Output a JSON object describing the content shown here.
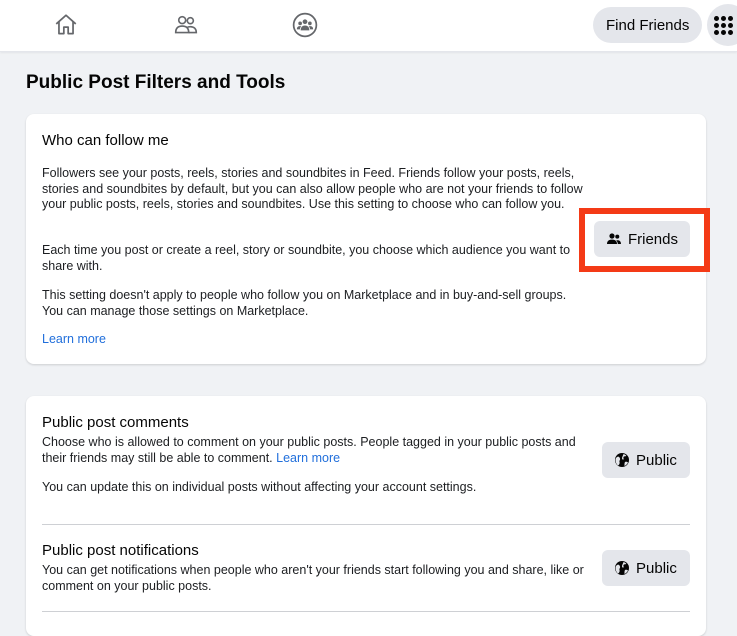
{
  "topbar": {
    "icons": [
      "home-icon",
      "friends-icon",
      "groups-icon"
    ],
    "find_friends_label": "Find Friends",
    "menu_icon": "menu-grid-icon"
  },
  "page": {
    "title": "Public Post Filters and Tools"
  },
  "who_can_follow": {
    "title": "Who can follow me",
    "paragraph1": "Followers see your posts, reels, stories and soundbites in Feed. Friends follow your posts, reels, stories and soundbites by default, but you can also allow people who are not your friends to follow your public posts, reels, stories and soundbites. Use this setting to choose who can follow you.",
    "paragraph2": "Each time you post or create a reel, story or soundbite, you choose which audience you want to share with.",
    "paragraph3": "This setting doesn't apply to people who follow you on Marketplace and in buy-and-sell groups. You can manage those settings on Marketplace.",
    "learn_more": "Learn more",
    "audience_button": {
      "label": "Friends",
      "icon": "friends-icon"
    },
    "highlight_color": "#f43a16"
  },
  "public_post_comments": {
    "title": "Public post comments",
    "description": "Choose who is allowed to comment on your public posts. People tagged in your public posts and their friends may still be able to comment.",
    "learn_more": "Learn more",
    "note": "You can update this on individual posts without affecting your account settings.",
    "audience_button": {
      "label": "Public",
      "icon": "globe-icon"
    }
  },
  "public_post_notifications": {
    "title": "Public post notifications",
    "description": "You can get notifications when people who aren't your friends start following you and share, like or comment on your public posts.",
    "audience_button": {
      "label": "Public",
      "icon": "globe-icon"
    }
  },
  "colors": {
    "link": "#216fdb",
    "button_bg": "#e4e6eb",
    "page_bg": "#f0f2f5"
  }
}
